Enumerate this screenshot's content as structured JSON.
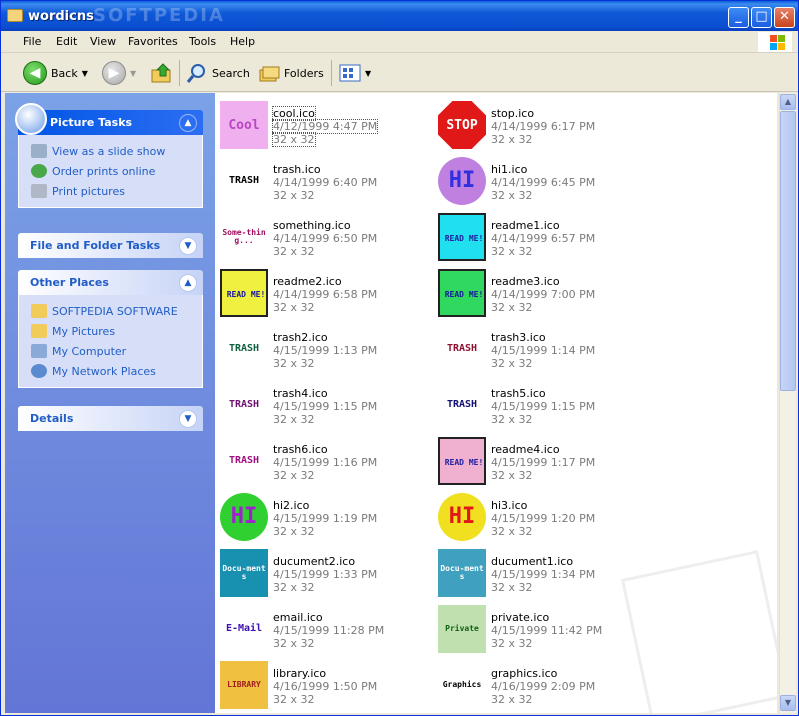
{
  "window": {
    "title": "wordicns",
    "watermark": "SOFTPEDIA"
  },
  "menu": [
    "File",
    "Edit",
    "View",
    "Favorites",
    "Tools",
    "Help"
  ],
  "toolbar": {
    "back": "Back",
    "search": "Search",
    "folders": "Folders"
  },
  "sidebar": {
    "picture_tasks": {
      "title": "Picture Tasks",
      "items": [
        "View as a slide show",
        "Order prints online",
        "Print pictures"
      ]
    },
    "file_tasks": {
      "title": "File and Folder Tasks"
    },
    "other_places": {
      "title": "Other Places",
      "items": [
        "SOFTPEDIA SOFTWARE",
        "My Pictures",
        "My Computer",
        "My Network Places"
      ]
    },
    "details": {
      "title": "Details"
    }
  },
  "files": [
    {
      "name": "cool.ico",
      "date": "4/12/1999 4:47 PM",
      "dim": "32 x 32",
      "icon": "cool-icon",
      "label": "Cool",
      "fg": "#b848c0",
      "bg": "#f0b0f0"
    },
    {
      "name": "stop.ico",
      "date": "4/14/1999 6:17 PM",
      "dim": "32 x 32",
      "icon": "stop-sign-icon",
      "label": "STOP",
      "fg": "#ffffff",
      "bg": "#e01818"
    },
    {
      "name": "trash.ico",
      "date": "4/14/1999 6:40 PM",
      "dim": "32 x 32",
      "icon": "trash-icon",
      "label": "TRASH",
      "fg": "#000000",
      "bg": "#ffffff"
    },
    {
      "name": "hi1.ico",
      "date": "4/14/1999 6:45 PM",
      "dim": "32 x 32",
      "icon": "hi-icon",
      "label": "HI",
      "fg": "#3030e0",
      "bg": "#c080e0"
    },
    {
      "name": "something.ico",
      "date": "4/14/1999 6:50 PM",
      "dim": "32 x 32",
      "icon": "something-icon",
      "label": "Some-thing...",
      "fg": "#a01060",
      "bg": "#ffffff"
    },
    {
      "name": "readme1.ico",
      "date": "4/14/1999 6:57 PM",
      "dim": "32 x 32",
      "icon": "readme-icon",
      "label": "READ ME!",
      "fg": "#2020a0",
      "bg": "#20e0f0"
    },
    {
      "name": "readme2.ico",
      "date": "4/14/1999 6:58 PM",
      "dim": "32 x 32",
      "icon": "readme-icon",
      "label": "READ ME!",
      "fg": "#1818a0",
      "bg": "#f0f040"
    },
    {
      "name": "readme3.ico",
      "date": "4/14/1999 7:00 PM",
      "dim": "32 x 32",
      "icon": "readme-icon",
      "label": "READ ME!",
      "fg": "#1818a0",
      "bg": "#30d860"
    },
    {
      "name": "trash2.ico",
      "date": "4/15/1999 1:13 PM",
      "dim": "32 x 32",
      "icon": "trash-icon",
      "label": "TRASH",
      "fg": "#106040",
      "bg": "#ffffff"
    },
    {
      "name": "trash3.ico",
      "date": "4/15/1999 1:14 PM",
      "dim": "32 x 32",
      "icon": "trash-icon",
      "label": "TRASH",
      "fg": "#901030",
      "bg": "#ffffff"
    },
    {
      "name": "trash4.ico",
      "date": "4/15/1999 1:15 PM",
      "dim": "32 x 32",
      "icon": "trash-icon",
      "label": "TRASH",
      "fg": "#701070",
      "bg": "#ffffff"
    },
    {
      "name": "trash5.ico",
      "date": "4/15/1999 1:15 PM",
      "dim": "32 x 32",
      "icon": "trash-icon",
      "label": "TRASH",
      "fg": "#101070",
      "bg": "#ffffff"
    },
    {
      "name": "trash6.ico",
      "date": "4/15/1999 1:16 PM",
      "dim": "32 x 32",
      "icon": "trash-icon",
      "label": "TRASH",
      "fg": "#a01080",
      "bg": "#ffffff"
    },
    {
      "name": "readme4.ico",
      "date": "4/15/1999 1:17 PM",
      "dim": "32 x 32",
      "icon": "readme-icon",
      "label": "READ ME!",
      "fg": "#2020a0",
      "bg": "#f0b0d0"
    },
    {
      "name": "hi2.ico",
      "date": "4/15/1999 1:19 PM",
      "dim": "32 x 32",
      "icon": "hi-icon",
      "label": "HI",
      "fg": "#a020d0",
      "bg": "#30d030"
    },
    {
      "name": "hi3.ico",
      "date": "4/15/1999 1:20 PM",
      "dim": "32 x 32",
      "icon": "hi-icon",
      "label": "HI",
      "fg": "#e01818",
      "bg": "#f0e020"
    },
    {
      "name": "ducument2.ico",
      "date": "4/15/1999 1:33 PM",
      "dim": "32 x 32",
      "icon": "documents-icon",
      "label": "Docu-ments",
      "fg": "#ffffff",
      "bg": "#1890b0"
    },
    {
      "name": "ducument1.ico",
      "date": "4/15/1999 1:34 PM",
      "dim": "32 x 32",
      "icon": "documents-icon",
      "label": "Docu-ments",
      "fg": "#ffffff",
      "bg": "#40a0c0"
    },
    {
      "name": "email.ico",
      "date": "4/15/1999 11:28 PM",
      "dim": "32 x 32",
      "icon": "email-icon",
      "label": "E-Mail",
      "fg": "#4010b0",
      "bg": "#ffffff"
    },
    {
      "name": "private.ico",
      "date": "4/15/1999 11:42 PM",
      "dim": "32 x 32",
      "icon": "lock-icon",
      "label": "Private",
      "fg": "#106010",
      "bg": "#c0e0b0"
    },
    {
      "name": "library.ico",
      "date": "4/16/1999 1:50 PM",
      "dim": "32 x 32",
      "icon": "library-icon",
      "label": "LIBRARY",
      "fg": "#a02020",
      "bg": "#f0c040"
    },
    {
      "name": "graphics.ico",
      "date": "4/16/1999 2:09 PM",
      "dim": "32 x 32",
      "icon": "graphics-icon",
      "label": "Graphics",
      "fg": "#000000",
      "bg": "#ffffff"
    }
  ]
}
